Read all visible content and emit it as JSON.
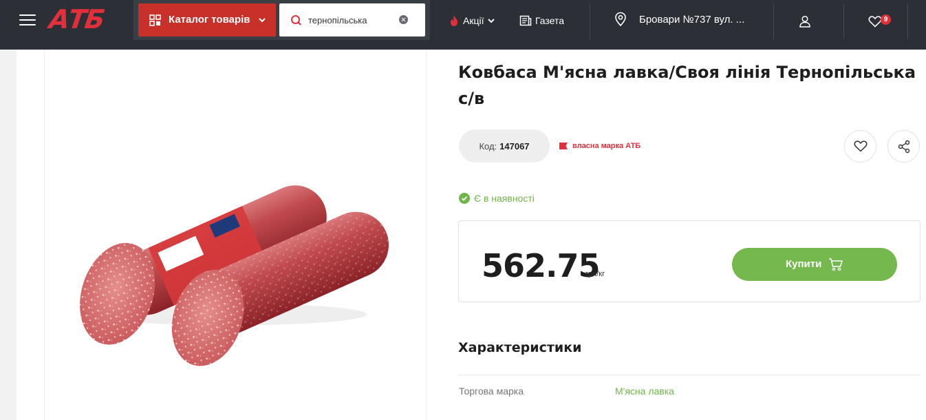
{
  "header": {
    "logo_text": "АТБ",
    "catalog_label": "Каталог товарів",
    "search": {
      "value": "тернопільська",
      "placeholder": ""
    },
    "promo_label": "Акції",
    "newspaper_label": "Газета",
    "store_label": "Бровари №737 вул. ...",
    "favorites_count": "9"
  },
  "product": {
    "title": "Ковбаса М'ясна лавка/Своя лінія Тернопільська с/в",
    "code_label": "Код:",
    "code_value": "147067",
    "own_brand_label": "власна марка АТБ",
    "stock_label": "Є в наявності",
    "price": "562.75",
    "unit": "грн/кг",
    "buy_label": "Купити"
  },
  "characteristics": {
    "title": "Характеристики",
    "rows": [
      {
        "name": "Торгова марка",
        "value": "М'ясна лавка"
      }
    ]
  },
  "colors": {
    "header_bg": "#2c3036",
    "brand_red": "#c8302a",
    "accent_green": "#75b94e"
  }
}
